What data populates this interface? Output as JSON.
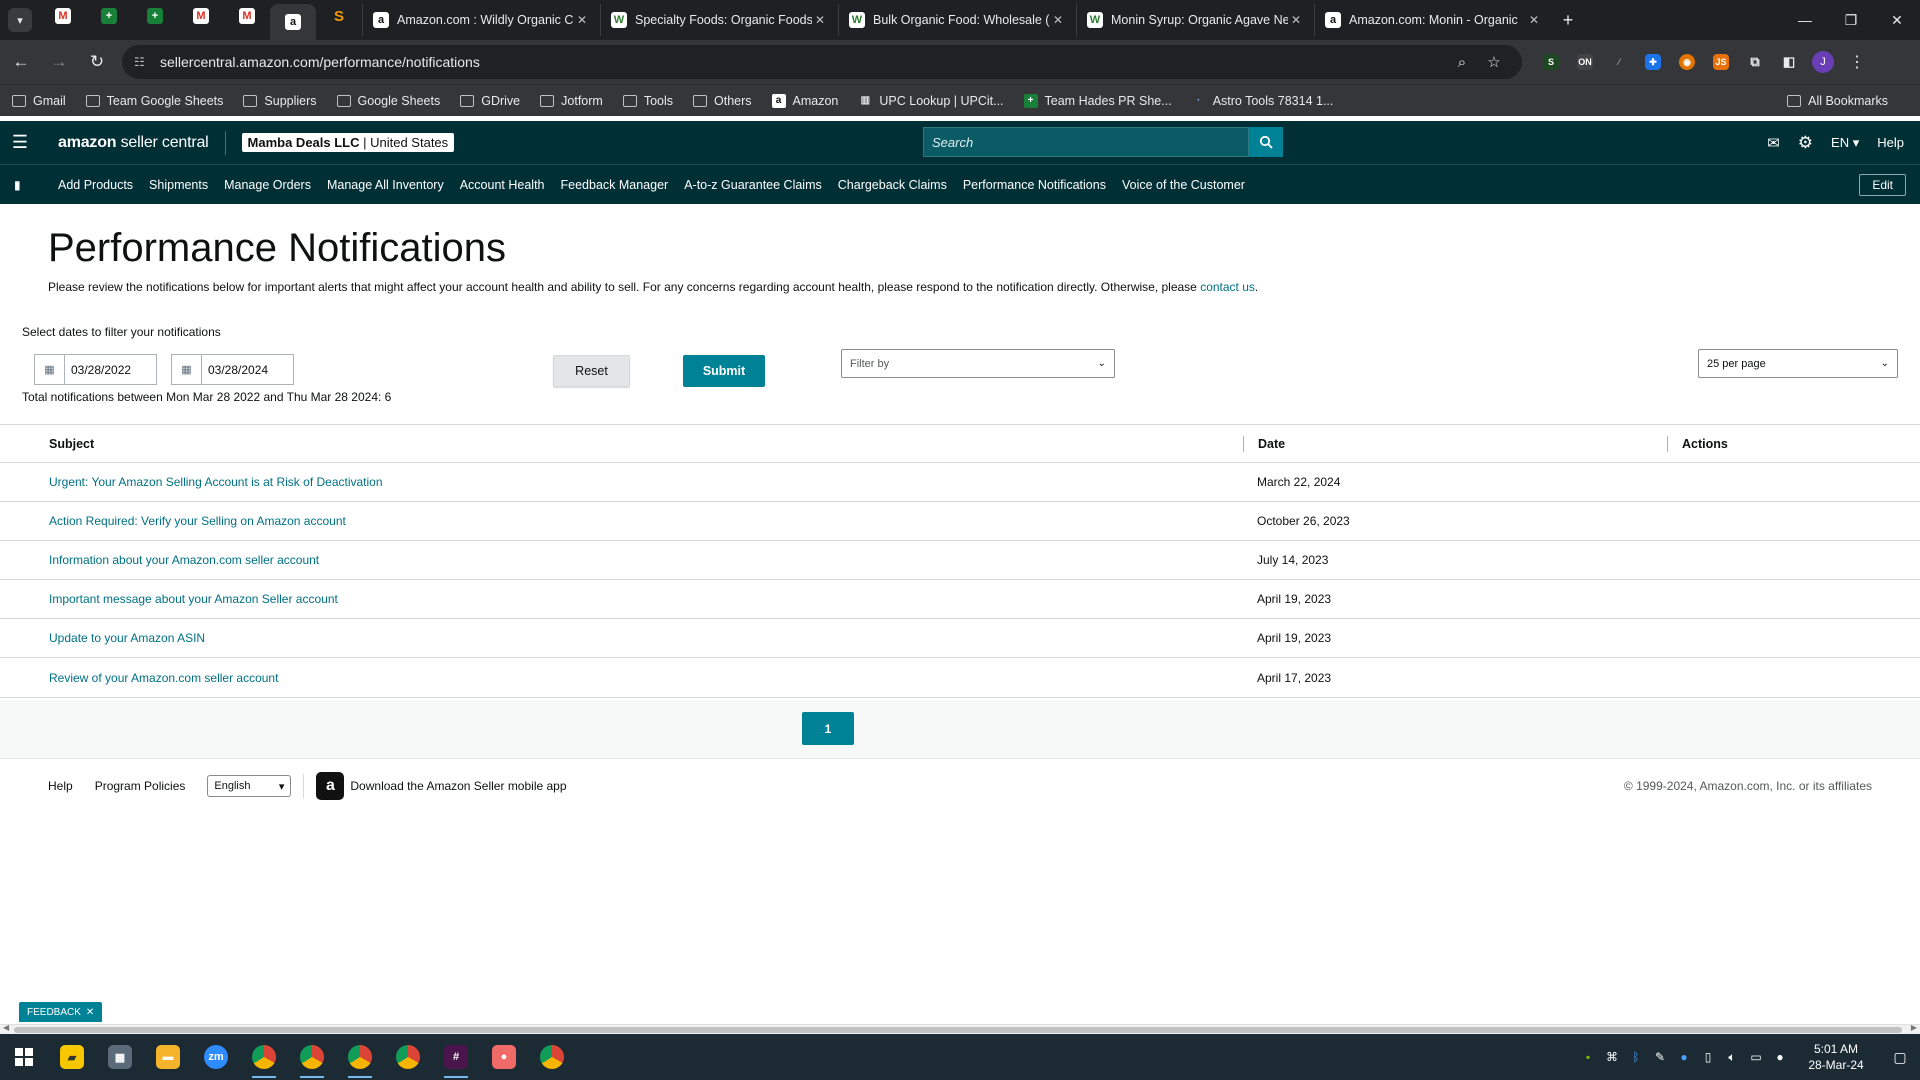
{
  "browser": {
    "pinned_tabs": [
      {
        "icon": "gmail-icon",
        "glyph": "M"
      },
      {
        "icon": "google-sheets-icon",
        "glyph": "+"
      },
      {
        "icon": "google-sheets-icon",
        "glyph": "+"
      },
      {
        "icon": "gmail-icon",
        "glyph": "M"
      },
      {
        "icon": "gmail-icon",
        "glyph": "M"
      },
      {
        "icon": "amazon-icon",
        "glyph": "a"
      },
      {
        "icon": "s-icon",
        "glyph": "S"
      }
    ],
    "tabs": [
      {
        "title": "Amazon.com : Wildly Organic C",
        "icon": "amazon-icon",
        "glyph": "a"
      },
      {
        "title": "Specialty Foods: Organic Foods",
        "icon": "w-icon",
        "glyph": "W"
      },
      {
        "title": "Bulk Organic Food: Wholesale (",
        "icon": "w-icon",
        "glyph": "W"
      },
      {
        "title": "Monin Syrup: Organic Agave Ne",
        "icon": "w-icon",
        "glyph": "W"
      },
      {
        "title": "Amazon.com: Monin - Organic",
        "icon": "amazon-icon",
        "glyph": "a"
      }
    ],
    "url": "sellercentral.amazon.com/performance/notifications",
    "bookmarks": [
      {
        "label": "Gmail",
        "type": "folder"
      },
      {
        "label": "Team Google Sheets",
        "type": "folder"
      },
      {
        "label": "Suppliers",
        "type": "folder"
      },
      {
        "label": "Google Sheets",
        "type": "folder"
      },
      {
        "label": "GDrive",
        "type": "folder"
      },
      {
        "label": "Jotform",
        "type": "folder"
      },
      {
        "label": "Tools",
        "type": "folder"
      },
      {
        "label": "Others",
        "type": "folder"
      },
      {
        "label": "Amazon",
        "type": "amazon"
      },
      {
        "label": "UPC Lookup | UPCit...",
        "type": "upc"
      },
      {
        "label": "Team Hades PR She...",
        "type": "sheets"
      },
      {
        "label": "Astro Tools 78314 1...",
        "type": "astro"
      }
    ],
    "all_bookmarks": "All Bookmarks"
  },
  "header": {
    "logo_main": "amazon",
    "logo_sub": " seller central",
    "account_name": "Mamba Deals LLC",
    "account_region": " | United States",
    "search_placeholder": "Search",
    "language": "EN",
    "help": "Help"
  },
  "nav": {
    "items": [
      "Add Products",
      "Shipments",
      "Manage Orders",
      "Manage All Inventory",
      "Account Health",
      "Feedback Manager",
      "A-to-z Guarantee Claims",
      "Chargeback Claims",
      "Performance Notifications",
      "Voice of the Customer"
    ],
    "edit": "Edit"
  },
  "page": {
    "title": "Performance Notifications",
    "intro": "Please review the notifications below for important alerts that might affect your account health and ability to sell. For any concerns regarding account health, please respond to the notification directly. Otherwise, please ",
    "contact_link": "contact us",
    "intro_end": ".",
    "filter_label": "Select dates to filter your notifications",
    "date_from": "03/28/2022",
    "date_to": "03/28/2024",
    "total_text": "Total notifications between Mon Mar 28 2022 and Thu Mar 28 2024: 6",
    "reset": "Reset",
    "submit": "Submit",
    "filter_by": "Filter by",
    "per_page": "25 per page"
  },
  "table": {
    "headers": {
      "subject": "Subject",
      "date": "Date",
      "actions": "Actions"
    },
    "rows": [
      {
        "subject": "Urgent: Your Amazon Selling Account is at Risk of Deactivation",
        "date": "March 22, 2024"
      },
      {
        "subject": "Action Required: Verify your Selling on Amazon account",
        "date": "October 26, 2023"
      },
      {
        "subject": "Information about your Amazon.com seller account",
        "date": "July 14, 2023"
      },
      {
        "subject": "Important message about your Amazon Seller account",
        "date": "April 19, 2023"
      },
      {
        "subject": "Update to your Amazon ASIN",
        "date": "April 19, 2023"
      },
      {
        "subject": "Review of your Amazon.com seller account",
        "date": "April 17, 2023"
      }
    ]
  },
  "pagination": {
    "current": "1"
  },
  "footer": {
    "help": "Help",
    "program_policies": "Program Policies",
    "language": "English",
    "app_download": "Download the Amazon Seller mobile app",
    "copyright": "© 1999-2024, Amazon.com, Inc. or its affiliates"
  },
  "feedback": "FEEDBACK",
  "taskbar": {
    "time": "5:01 AM",
    "date": "28-Mar-24"
  },
  "colors": {
    "header_bg": "#002f36",
    "accent": "#008296",
    "link": "#007185"
  }
}
